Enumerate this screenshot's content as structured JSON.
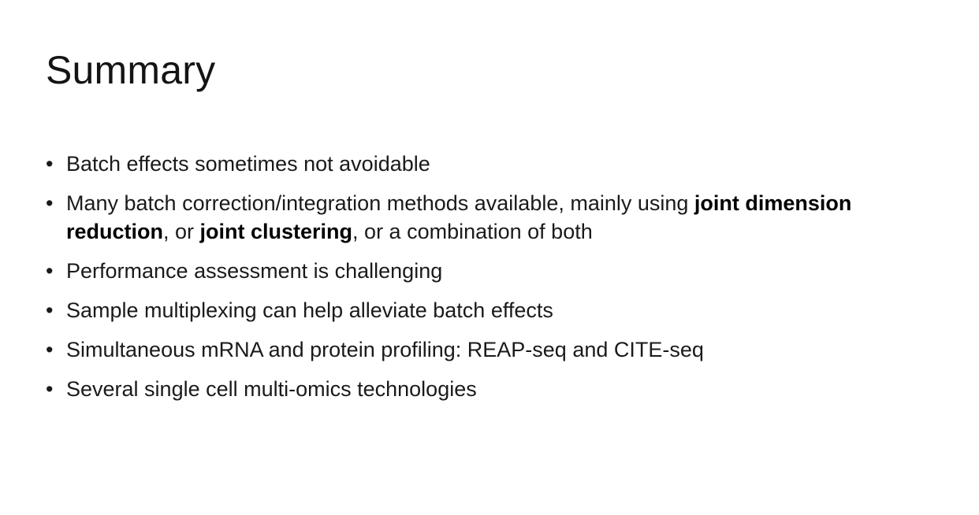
{
  "slide": {
    "title": "Summary",
    "bullet_symbol": "•",
    "bullets": [
      {
        "parts": [
          {
            "text": "Batch effects sometimes not avoidable"
          }
        ]
      },
      {
        "parts": [
          {
            "text": "Many batch correction/integration methods available, mainly using "
          },
          {
            "text": "joint dimension reduction",
            "bold": true
          },
          {
            "text": ", or "
          },
          {
            "text": "joint clustering",
            "bold": true
          },
          {
            "text": ", or a combination of both"
          }
        ]
      },
      {
        "parts": [
          {
            "text": "Performance assessment is challenging"
          }
        ]
      },
      {
        "parts": [
          {
            "text": "Sample multiplexing can help alleviate batch effects"
          }
        ]
      },
      {
        "parts": [
          {
            "text": "Simultaneous mRNA and protein profiling: REAP-seq and CITE-seq"
          }
        ]
      },
      {
        "parts": [
          {
            "text": "Several single cell multi-omics technologies"
          }
        ]
      }
    ]
  }
}
